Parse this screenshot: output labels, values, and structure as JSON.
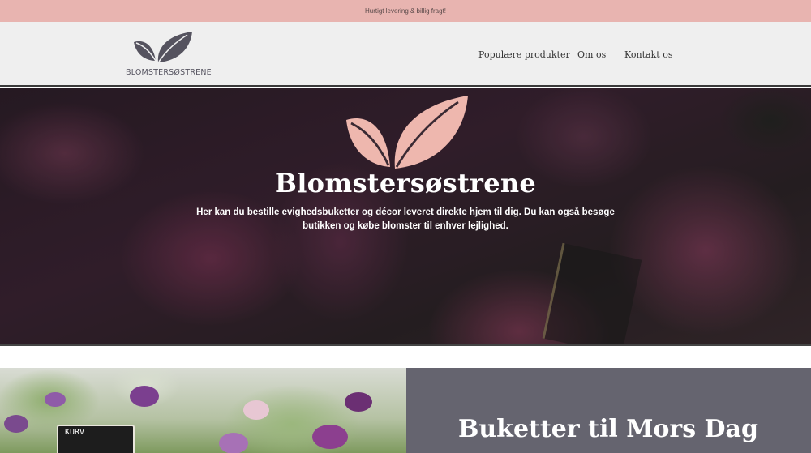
{
  "announcement": "Hurtigt levering & billig fragt!",
  "brand": {
    "name": "BLOMSTERSØSTRENE"
  },
  "nav": {
    "items": [
      "Populære produkter",
      "Om os",
      "Kontakt os"
    ]
  },
  "hero": {
    "title": "Blomstersøstrene",
    "text": "Her kan du bestille evighedsbuketter og décor leveret direkte hjem til dig. Du kan også besøge butikken og købe blomster til enhver lejlighed."
  },
  "feature": {
    "title": "Buketter til Mors Dag",
    "sign_text": "KURV"
  },
  "colors": {
    "accent_pink": "#e8b4b0",
    "logo_dark": "#55535f",
    "logo_pink": "#eeb7ae",
    "panel": "#65646f"
  },
  "icons": {
    "logo": "leaf-logo-icon"
  }
}
